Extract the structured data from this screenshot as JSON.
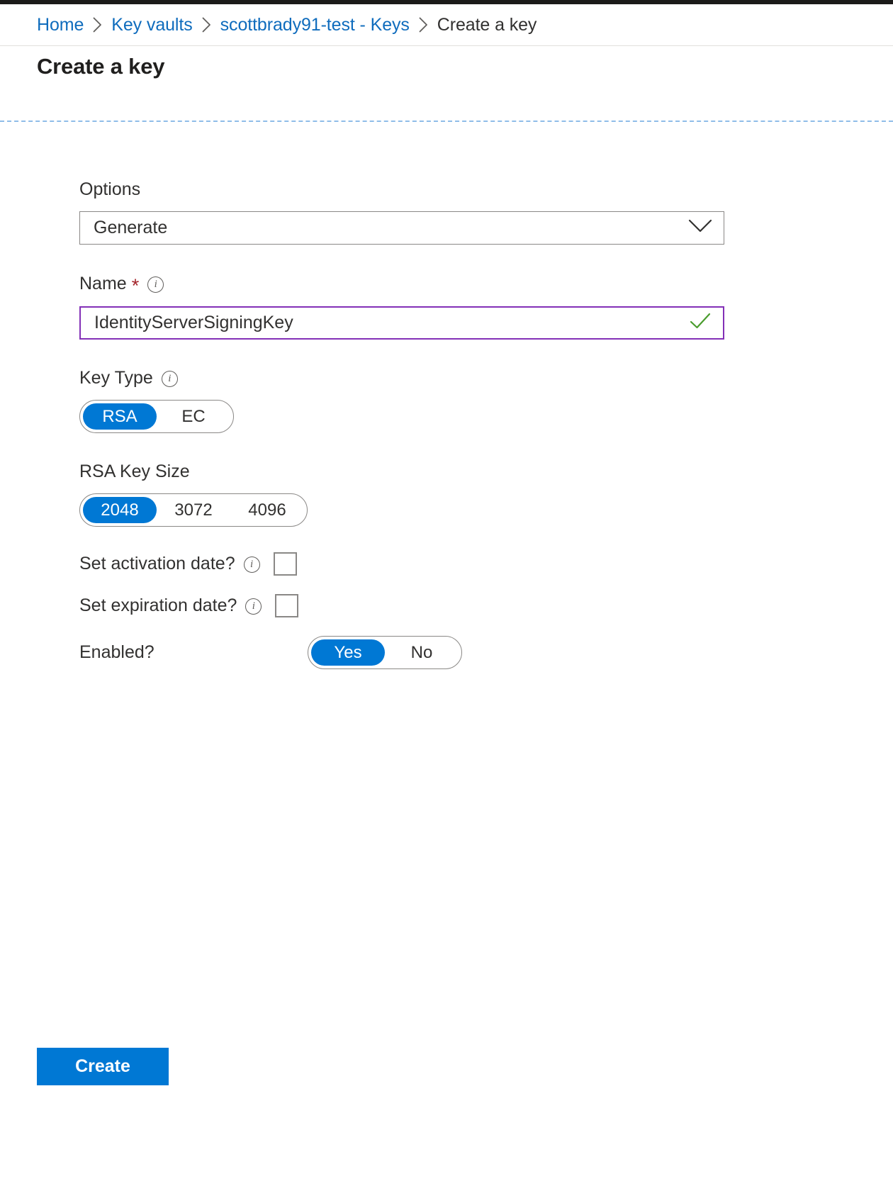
{
  "window": {
    "accent_color": "#0078d4",
    "link_color": "#0f6cbd",
    "required_color": "#a4262c",
    "focus_border_color": "#8330b7",
    "valid_check_color": "#107c10"
  },
  "breadcrumb": {
    "items": [
      {
        "label": "Home",
        "current": false
      },
      {
        "label": "Key vaults",
        "current": false
      },
      {
        "label": "scottbrady91-test - Keys",
        "current": false
      },
      {
        "label": "Create a key",
        "current": true
      }
    ],
    "separator_icon": "chevron-right-icon"
  },
  "page": {
    "title": "Create a key"
  },
  "form": {
    "options": {
      "label": "Options",
      "value": "Generate",
      "chevron_icon": "chevron-down-icon"
    },
    "name": {
      "label": "Name",
      "required_marker": "*",
      "info_icon": "info-icon",
      "value": "IdentityServerSigningKey",
      "placeholder": "",
      "validation_icon": "checkmark-icon"
    },
    "key_type": {
      "label": "Key Type",
      "info_icon": "info-icon",
      "options": [
        "RSA",
        "EC"
      ],
      "selected": "RSA"
    },
    "rsa_key_size": {
      "label": "RSA Key Size",
      "options": [
        "2048",
        "3072",
        "4096"
      ],
      "selected": "2048"
    },
    "set_activation_date": {
      "label": "Set activation date?",
      "info_icon": "info-icon",
      "checked": false
    },
    "set_expiration_date": {
      "label": "Set expiration date?",
      "info_icon": "info-icon",
      "checked": false
    },
    "enabled": {
      "label": "Enabled?",
      "options": [
        "Yes",
        "No"
      ],
      "selected": "Yes"
    }
  },
  "footer": {
    "create_label": "Create"
  }
}
